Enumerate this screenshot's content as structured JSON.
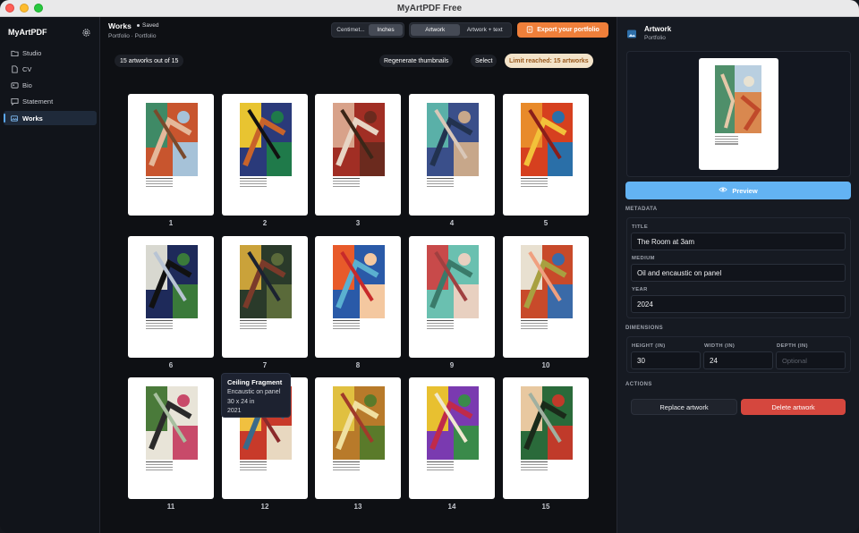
{
  "window": {
    "title": "MyArtPDF Free"
  },
  "sidebar": {
    "brand": "MyArtPDF",
    "items": [
      {
        "label": "Studio",
        "icon": "folder-icon"
      },
      {
        "label": "CV",
        "icon": "document-icon"
      },
      {
        "label": "Bio",
        "icon": "id-card-icon"
      },
      {
        "label": "Statement",
        "icon": "speech-bubble-icon"
      },
      {
        "label": "Works",
        "icon": "images-icon",
        "active": true
      }
    ]
  },
  "header": {
    "title": "Works",
    "saved": "Saved",
    "breadcrumb": "Portfolio · Portfolio",
    "units": [
      {
        "label": "Centimet...",
        "selected": false
      },
      {
        "label": "Inches",
        "selected": true
      }
    ],
    "views": [
      {
        "label": "Artwork",
        "selected": true
      },
      {
        "label": "Artwork + text",
        "selected": false
      }
    ],
    "export_label": "Export your portfolio"
  },
  "toolbar": {
    "count": "15 artworks out of 15",
    "regenerate": "Regenerate thumbnails",
    "select": "Select",
    "limit": "Limit reached: 15 artworks"
  },
  "works": [
    {
      "n": "1",
      "colors": [
        "#c8552e",
        "#3f8a66",
        "#a6c2d8",
        "#e4b89a",
        "#7a4a2c"
      ]
    },
    {
      "n": "2",
      "colors": [
        "#2a3a7a",
        "#e8c431",
        "#1f7a4a",
        "#c8632a",
        "#111"
      ]
    },
    {
      "n": "3",
      "colors": [
        "#a12e24",
        "#d8a28a",
        "#6b2a1e",
        "#e7d4c4",
        "#3b2618"
      ]
    },
    {
      "n": "4",
      "colors": [
        "#3a4f8a",
        "#5ab0a8",
        "#c7a78a",
        "#22324f",
        "#d9c7b8"
      ]
    },
    {
      "n": "5",
      "colors": [
        "#d6401f",
        "#e88a2a",
        "#2a6fa8",
        "#f2c23a",
        "#8a1e1a"
      ]
    },
    {
      "n": "6",
      "colors": [
        "#1e2a5a",
        "#d8d8d0",
        "#3a7a3a",
        "#111",
        "#b8c4d4"
      ]
    },
    {
      "n": "7",
      "colors": [
        "#2a3a2a",
        "#caa23a",
        "#5a6a3a",
        "#7a3a2a",
        "#1b2230"
      ]
    },
    {
      "n": "8",
      "colors": [
        "#2a5aa8",
        "#e85a2a",
        "#f4c8a0",
        "#5ab0d0",
        "#c82a2a"
      ]
    },
    {
      "n": "9",
      "colors": [
        "#6ac0b0",
        "#c84a4a",
        "#e8d0c0",
        "#3a7a6a",
        "#a04040"
      ]
    },
    {
      "n": "10",
      "colors": [
        "#c84a2a",
        "#e8e0d0",
        "#3a6aa8",
        "#a8a040",
        "#f0a080"
      ]
    },
    {
      "n": "11",
      "colors": [
        "#e8e4d8",
        "#4a7a3a",
        "#c84a6a",
        "#2a2a2a",
        "#a8c0a0"
      ]
    },
    {
      "n": "12",
      "colors": [
        "#c83a2a",
        "#f0c040",
        "#e8d8c0",
        "#3a6a8a",
        "#8a2a2a"
      ]
    },
    {
      "n": "13",
      "colors": [
        "#b87a2a",
        "#e0c040",
        "#5a7a2a",
        "#f0e0a0",
        "#a03a2a"
      ]
    },
    {
      "n": "14",
      "colors": [
        "#7a3ab0",
        "#e8c030",
        "#3a8a4a",
        "#c02a4a",
        "#f0e8d0"
      ]
    },
    {
      "n": "15",
      "colors": [
        "#2a6a3a",
        "#e8c8a0",
        "#c03a2a",
        "#1a2a1a",
        "#a0b0a0"
      ]
    }
  ],
  "tooltip": {
    "title": "Ceiling Fragment",
    "medium": "Encaustic on panel",
    "dimensions": "30 x 24 in",
    "year": "2021"
  },
  "panel": {
    "title": "Artwork",
    "subtitle": "Portfolio",
    "preview_label": "Preview",
    "metadata_section": "METADATA",
    "title_label": "TITLE",
    "title_value": "The Room at 3am",
    "medium_label": "MEDIUM",
    "medium_value": "Oil and encaustic on panel",
    "year_label": "YEAR",
    "year_value": "2024",
    "dimensions_section": "DIMENSIONS",
    "height_label": "HEIGHT (IN)",
    "height_value": "30",
    "width_label": "WIDTH (IN)",
    "width_value": "24",
    "depth_label": "DEPTH (IN)",
    "depth_placeholder": "Optional",
    "actions_section": "ACTIONS",
    "replace_label": "Replace artwork",
    "delete_label": "Delete artwork"
  },
  "colors": {
    "accent": "#63b3f3",
    "export": "#ef7f3a",
    "danger": "#d5473e",
    "limit_bg": "#f3e3c9",
    "limit_text": "#9a5a1e"
  }
}
